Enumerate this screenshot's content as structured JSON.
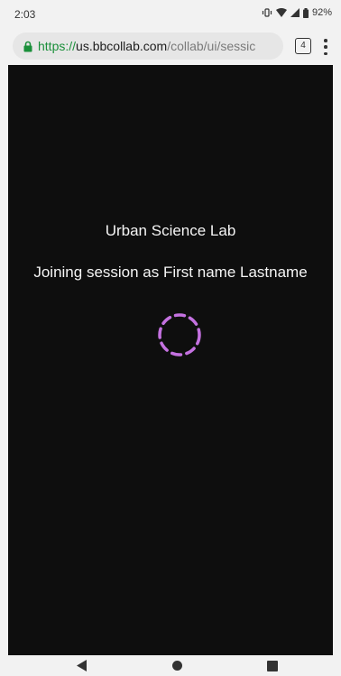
{
  "status": {
    "time": "2:03",
    "battery": "92%"
  },
  "browser": {
    "url_scheme": "https://",
    "url_host": "us.bbcollab.com",
    "url_path": "/collab/ui/sessic",
    "tab_count": "4"
  },
  "session": {
    "title": "Urban Science Lab",
    "joining_text": "Joining session as First name Lastname"
  },
  "colors": {
    "background": "#0e0e0e",
    "spinner": "#c471e0",
    "url_scheme": "#1a8f3a"
  }
}
